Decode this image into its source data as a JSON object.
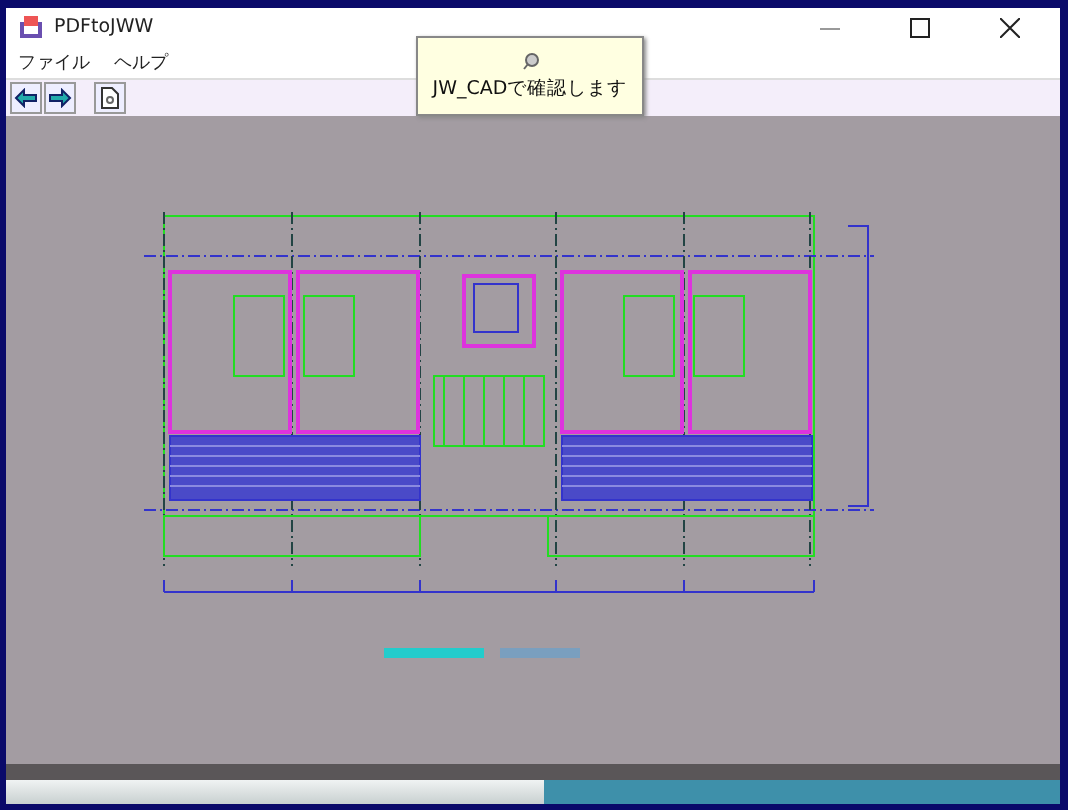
{
  "window": {
    "title": "PDFtoJWW"
  },
  "menu": [
    {
      "label": "ファイル"
    },
    {
      "label": "ヘルプ"
    }
  ],
  "toolbar": [
    {
      "kind": "back"
    },
    {
      "kind": "forward"
    },
    {
      "kind": "page"
    }
  ],
  "tooltip": {
    "text": "JW_CADで確認します"
  },
  "progress": {
    "level": 0.51
  }
}
